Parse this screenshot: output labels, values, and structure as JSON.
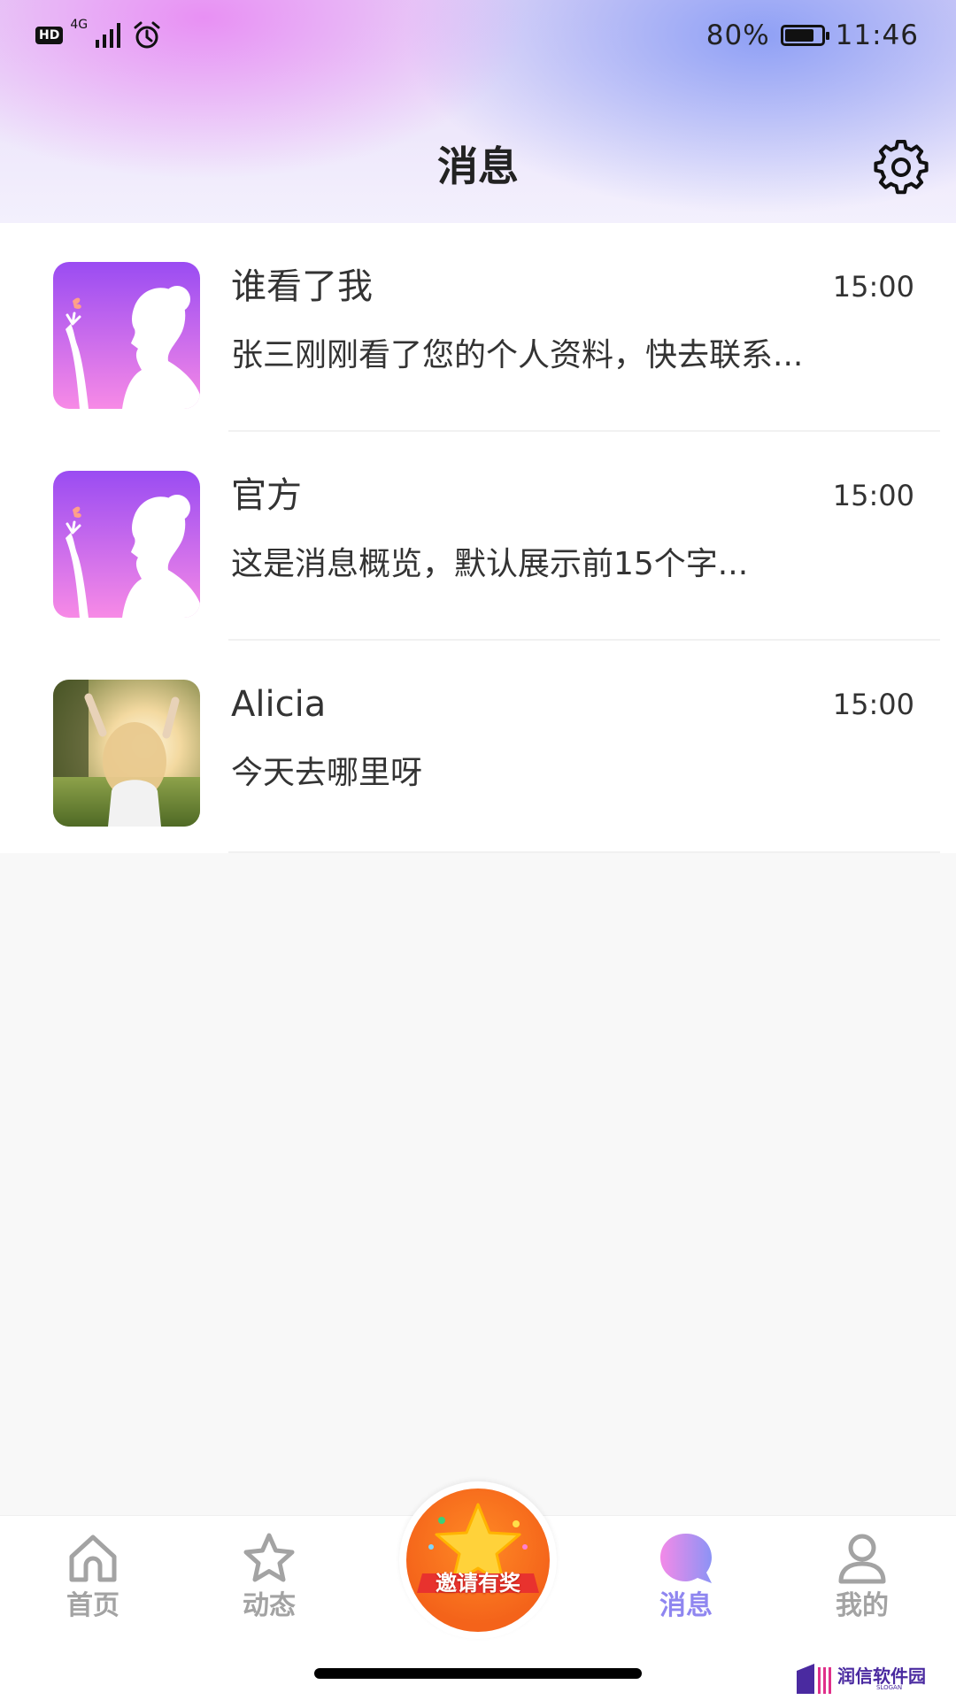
{
  "status_bar": {
    "hd": "HD",
    "network": "4G",
    "battery_percent": "80%",
    "battery_level": 0.8,
    "time": "11:46"
  },
  "header": {
    "title": "消息",
    "settings_icon": "gear-icon"
  },
  "messages": [
    {
      "title": "谁看了我",
      "time": "15:00",
      "preview": "张三刚刚看了您的个人资料，快去联系...",
      "avatar": "app-logo"
    },
    {
      "title": "官方",
      "time": "15:00",
      "preview": "这是消息概览，默认展示前15个字...",
      "avatar": "app-logo"
    },
    {
      "title": "Alicia",
      "time": "15:00",
      "preview": "今天去哪里呀",
      "avatar": "user-photo"
    }
  ],
  "tabbar": {
    "home": {
      "label": "首页",
      "icon": "home-icon"
    },
    "moments": {
      "label": "动态",
      "icon": "star-icon"
    },
    "invite": {
      "label": "邀请有奖",
      "icon": "star-badge-icon"
    },
    "messages": {
      "label": "消息",
      "icon": "chat-bubble-icon",
      "active": true
    },
    "mine": {
      "label": "我的",
      "icon": "user-icon"
    }
  },
  "watermark": {
    "text": "润信软件园",
    "sub": "SLOGAN"
  },
  "colors": {
    "active_tab": "#8f86f0",
    "inactive_tab": "#a3a3a3",
    "invite_orange": "#f4631a",
    "avatar_gradient_top": "#9a4cf2",
    "avatar_gradient_bottom": "#f78ae6"
  }
}
